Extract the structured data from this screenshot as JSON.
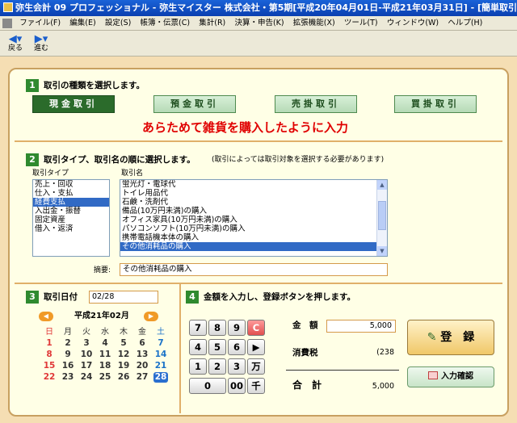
{
  "window": {
    "title": "弥生会計 09 プロフェッショナル - 弥生マイスター 株式会社・第5期[平成20年04月01日-平成21年03月31日] - [簡単取引入力]"
  },
  "menu": [
    "ファイル(F)",
    "編集(E)",
    "設定(S)",
    "帳簿・伝票(C)",
    "集計(R)",
    "決算・申告(K)",
    "拡張機能(X)",
    "ツール(T)",
    "ウィンドウ(W)",
    "ヘルプ(H)"
  ],
  "toolbar": {
    "back": "戻る",
    "forward": "進む"
  },
  "step1": {
    "num": "1",
    "title": "取引の種類を選択します。",
    "buttons": [
      "現金取引",
      "預金取引",
      "売掛取引",
      "買掛取引"
    ],
    "annotation": "あらためて雑貨を購入したように入力"
  },
  "step2": {
    "num": "2",
    "title": "取引タイプ、取引名の順に選択します。",
    "note": "(取引によっては取引対象を選択する必要があります)",
    "type_label": "取引タイプ",
    "types": [
      "売上・回収",
      "仕入・支払",
      "経費支払",
      "入出金・振替",
      "固定資産",
      "借入・返済"
    ],
    "selected_type_index": 2,
    "name_label": "取引名",
    "names": [
      "蛍光灯・電球代",
      "トイレ用品代",
      "石鹸・洗剤代",
      "備品(10万円未満)の購入",
      "オフィス家具(10万円未満)の購入",
      "パソコンソフト(10万円未満)の購入",
      "携帯電話機本体の購入",
      "その他消耗品の購入"
    ],
    "selected_name_index": 7,
    "memo_label": "摘要:",
    "memo_value": "その他消耗品の購入"
  },
  "step3": {
    "num": "3",
    "title": "取引日付",
    "date_value": "02/28",
    "month_label": "平成21年02月",
    "weekdays": [
      "日",
      "月",
      "火",
      "水",
      "木",
      "金",
      "土"
    ],
    "weeks": [
      [
        "1",
        "2",
        "3",
        "4",
        "5",
        "6",
        "7"
      ],
      [
        "8",
        "9",
        "10",
        "11",
        "12",
        "13",
        "14"
      ],
      [
        "15",
        "16",
        "17",
        "18",
        "19",
        "20",
        "21"
      ],
      [
        "22",
        "23",
        "24",
        "25",
        "26",
        "27",
        "28"
      ]
    ],
    "selected_day": "28"
  },
  "step4": {
    "num": "4",
    "title": "金額を入力し、登録ボタンを押します。",
    "keypad": [
      [
        "7",
        "8",
        "9",
        "C"
      ],
      [
        "4",
        "5",
        "6",
        "▶"
      ],
      [
        "1",
        "2",
        "3",
        "万"
      ],
      [
        "0",
        "00",
        "千"
      ]
    ],
    "amount_label": "金　額",
    "amount_value": "5,000",
    "tax_label": "消費税",
    "tax_value": "(238",
    "total_label": "合　計",
    "total_value": "5,000",
    "register_label": "登　録",
    "confirm_label": "入力確認"
  },
  "colors": {
    "accent": "#2f8a2f",
    "annotation": "#e00000",
    "selection": "#316ac5"
  },
  "icons": {
    "pencil": "pencil-icon",
    "grid": "grid-icon"
  }
}
